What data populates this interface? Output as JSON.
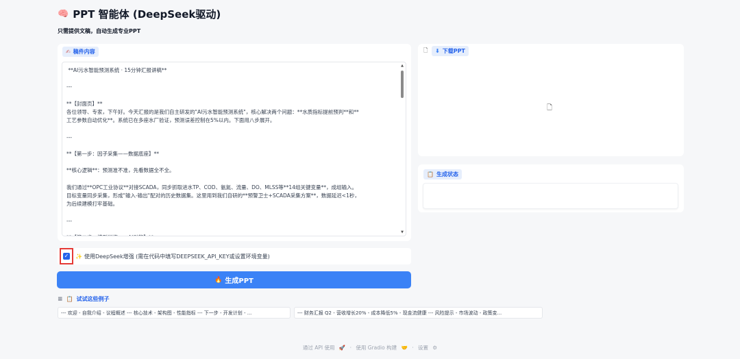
{
  "header": {
    "brain_icon": "🧠",
    "title": "PPT 智能体 (DeepSeek驱动)",
    "subtitle": "只需提供文稿，自动生成专业PPT"
  },
  "draft": {
    "chip_icon": "✍",
    "chip_label": "稿件内容",
    "text": " **AI污水智能预测系统 · 15分钟汇报讲稿**\n\n---\n\n**【封面页】**\n各位领导、专家，下午好。今天汇报的是我们自主研发的\"AI污水智能预测系统\"，核心解决两个问题：**水质指标提前预判**和**\n工艺参数自动优化**。系统已在多座水厂验证，预测误差控制在5%以内。下面用八步展开。\n\n---\n\n**【第一步：因子采集——数据底座】**\n\n**核心逻辑**：预测准不准，先看数据全不全。\n\n我们通过**OPC工业协议**对接SCADA，同步抓取进水TP、COD、氨氮、流量、DO、MLSS等**14组关键变量**，成组输入。\n目标变量同步采集，形成\"输入-输出\"配对的历史数据集。这里用到我们自研的**预警卫士+SCADA采集方案**，数据延迟<1秒，\n为后续建模打牢基础。\n\n---\n\n**【第二步：模型训练——AI引擎】**"
  },
  "deepseek": {
    "checked_mark": "✓",
    "sparkle_icon": "✨",
    "label": "使用DeepSeek增强 (需在代码中填写DEEPSEEK_API_KEY或设置环境变量)"
  },
  "generate_button": {
    "icon": "🔥",
    "label": "生成PPT"
  },
  "examples": {
    "list_icon": "≡",
    "clip_icon": "📋",
    "label": "试试这些例子",
    "items": [
      "--- 欢迎 - 自我介绍 - 议程概述 --- 核心技术 - 架构图 - 性能指标 --- 下一步 - 开发计划 - ...",
      "--- 财务汇报 Q2 - 营收增长20% - 成本降低5% - 现金流健康 --- 风险提示 - 市场波动 - 政策变..."
    ]
  },
  "download": {
    "file_icon": "🗋",
    "chip_icon": "⬇",
    "chip_label": "下载PPT",
    "center_icon": "🗋"
  },
  "status": {
    "chip_icon": "📋",
    "chip_label": "生成状态"
  },
  "footer": {
    "api": "通过 API 使用",
    "api_icon": "🚀",
    "sep1": "·",
    "gradio": "使用 Gradio 构建",
    "gradio_icon": "🤝",
    "sep2": "·",
    "settings": "设置",
    "settings_icon": "⚙"
  }
}
